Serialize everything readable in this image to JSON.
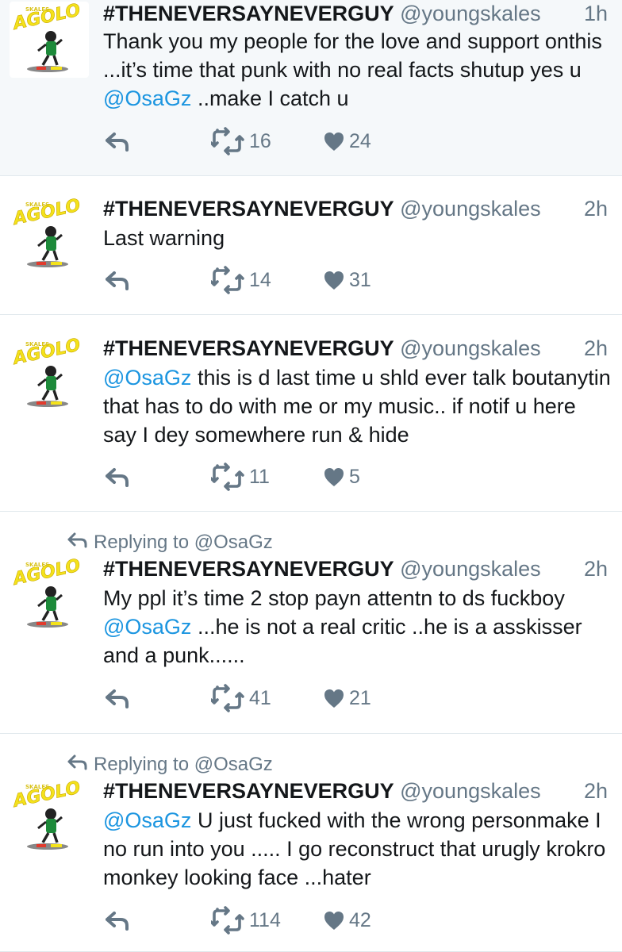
{
  "tweets": [
    {
      "name": "#THENEVERSAYNEVERGUY",
      "handle": "@youngskales",
      "time": "1h",
      "highlight": true,
      "reply_to": null,
      "text": [
        {
          "t": "Thank you my people for the love and support on"
        },
        {
          "t": "this ...it’s time that punk with no real facts shut"
        },
        {
          "t": "up yes u "
        },
        {
          "m": "@OsaGz"
        },
        {
          "t": " ..make I catch u"
        }
      ],
      "lines": 3,
      "retweets": "16",
      "likes": "24"
    },
    {
      "name": "#THENEVERSAYNEVERGUY",
      "handle": "@youngskales",
      "time": "2h",
      "highlight": false,
      "reply_to": null,
      "text": [
        {
          "t": "Last warning"
        }
      ],
      "lines": 1,
      "retweets": "14",
      "likes": "31"
    },
    {
      "name": "#THENEVERSAYNEVERGUY",
      "handle": "@youngskales",
      "time": "2h",
      "highlight": false,
      "reply_to": null,
      "text": [
        {
          "m": "@OsaGz"
        },
        {
          "t": " this is d last time u shld ever talk bout"
        },
        {
          "t": "anytin that has to do with me or my music.. if not"
        },
        {
          "t": "if u here say I dey somewhere run & hide"
        }
      ],
      "lines": 3,
      "retweets": "11",
      "likes": "5"
    },
    {
      "name": "#THENEVERSAYNEVERGUY",
      "handle": "@youngskales",
      "time": "2h",
      "highlight": false,
      "reply_to": "Replying to @OsaGz",
      "text": [
        {
          "t": "My ppl it’s time 2 stop payn attentn to ds fuck"
        },
        {
          "t": "boy "
        },
        {
          "m": "@OsaGz"
        },
        {
          "t": " ...he is not a real critic ..he is a ass"
        },
        {
          "t": "kisser and a punk......"
        }
      ],
      "lines": 3,
      "retweets": "41",
      "likes": "21"
    },
    {
      "name": "#THENEVERSAYNEVERGUY",
      "handle": "@youngskales",
      "time": "2h",
      "highlight": false,
      "reply_to": "Replying to @OsaGz",
      "text": [
        {
          "m": "@OsaGz"
        },
        {
          "t": " U just fucked with the wrong person"
        },
        {
          "t": "make I no run into you ..... I go reconstruct that ur"
        },
        {
          "t": "ugly krokro monkey looking face ...hater"
        }
      ],
      "lines": 3,
      "retweets": "114",
      "likes": "42"
    }
  ],
  "avatar_text": "AGOLO",
  "avatar_small_text": "SKALES",
  "icons": {
    "reply": "reply-icon",
    "retweet": "retweet-icon",
    "like": "heart-icon",
    "reply_context": "reply-context-icon"
  },
  "colors": {
    "mention": "#1b95e0",
    "muted": "#657786",
    "text": "#14171a",
    "highlight_bg": "#f5f8fa",
    "avatar_yellow": "#f4e21b",
    "avatar_green": "#1d8a3a"
  }
}
